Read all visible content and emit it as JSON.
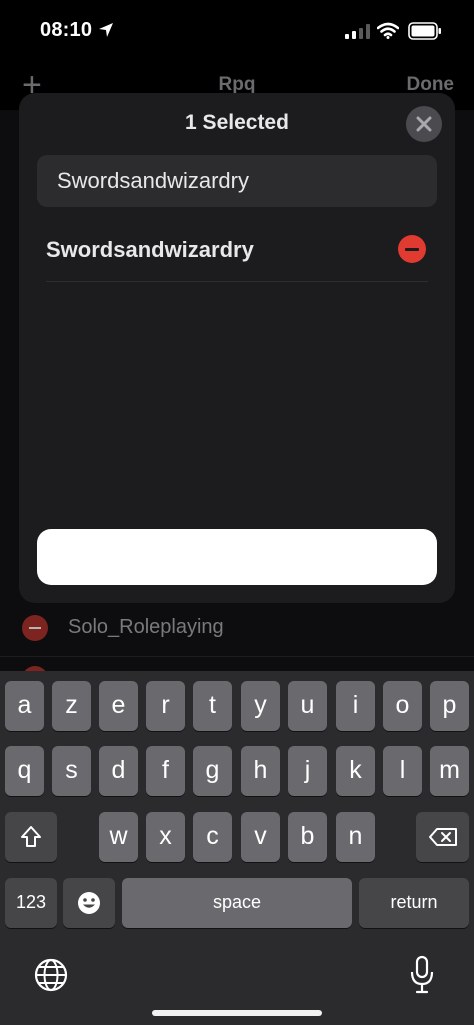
{
  "status_bar": {
    "time": "08:10"
  },
  "background": {
    "nav_add": "+",
    "nav_title": "Rpq",
    "nav_done": "Done",
    "list_item": "Solo_Roleplaying"
  },
  "sheet": {
    "title": "1 Selected",
    "search": {
      "value": "Swordsandwizardry",
      "placeholder": ""
    },
    "results": [
      {
        "label": "Swordsandwizardry"
      }
    ],
    "confirm_label": ""
  },
  "keyboard": {
    "row1": [
      "a",
      "z",
      "e",
      "r",
      "t",
      "y",
      "u",
      "i",
      "o",
      "p"
    ],
    "row2": [
      "q",
      "s",
      "d",
      "f",
      "g",
      "h",
      "j",
      "k",
      "l",
      "m"
    ],
    "row3": [
      "w",
      "x",
      "c",
      "v",
      "b",
      "n"
    ],
    "numbers_label": "123",
    "space_label": "space",
    "return_label": "return"
  },
  "colors": {
    "accent_destructive": "#e13a30",
    "sheet_bg": "#1c1c1e",
    "key_bg": "#6a6a6e"
  }
}
